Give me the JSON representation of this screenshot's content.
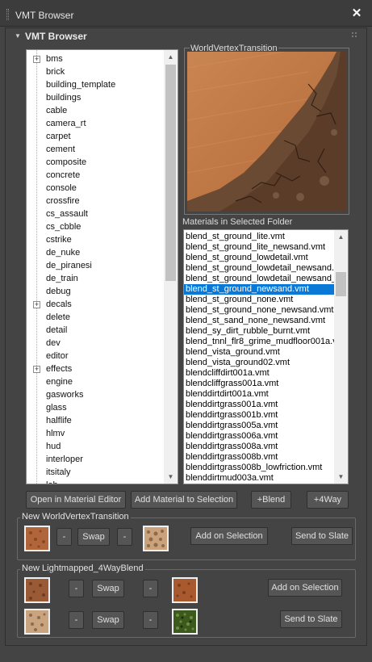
{
  "window": {
    "title": "VMT Browser"
  },
  "rollout": {
    "title": "VMT Browser"
  },
  "tree": {
    "items": [
      {
        "label": "bms",
        "expandable": true
      },
      {
        "label": "brick",
        "expandable": false
      },
      {
        "label": "building_template",
        "expandable": false
      },
      {
        "label": "buildings",
        "expandable": false
      },
      {
        "label": "cable",
        "expandable": false
      },
      {
        "label": "camera_rt",
        "expandable": false
      },
      {
        "label": "carpet",
        "expandable": false
      },
      {
        "label": "cement",
        "expandable": false
      },
      {
        "label": "composite",
        "expandable": false
      },
      {
        "label": "concrete",
        "expandable": false
      },
      {
        "label": "console",
        "expandable": false
      },
      {
        "label": "crossfire",
        "expandable": false
      },
      {
        "label": "cs_assault",
        "expandable": false
      },
      {
        "label": "cs_cbble",
        "expandable": false
      },
      {
        "label": "cstrike",
        "expandable": false
      },
      {
        "label": "de_nuke",
        "expandable": false
      },
      {
        "label": "de_piranesi",
        "expandable": false
      },
      {
        "label": "de_train",
        "expandable": false
      },
      {
        "label": "debug",
        "expandable": false
      },
      {
        "label": "decals",
        "expandable": true
      },
      {
        "label": "delete",
        "expandable": false
      },
      {
        "label": "detail",
        "expandable": false
      },
      {
        "label": "dev",
        "expandable": false
      },
      {
        "label": "editor",
        "expandable": false
      },
      {
        "label": "effects",
        "expandable": true
      },
      {
        "label": "engine",
        "expandable": false
      },
      {
        "label": "gasworks",
        "expandable": false
      },
      {
        "label": "glass",
        "expandable": false
      },
      {
        "label": "halflife",
        "expandable": false
      },
      {
        "label": "hlmv",
        "expandable": false
      },
      {
        "label": "hud",
        "expandable": false
      },
      {
        "label": "interloper",
        "expandable": false
      },
      {
        "label": "itsitaly",
        "expandable": false
      },
      {
        "label": "lab",
        "expandable": false
      }
    ]
  },
  "preview": {
    "label": "WorldVertexTransition"
  },
  "materials": {
    "label": "Materials in Selected Folder",
    "selected_index": 5,
    "items": [
      "blend_st_ground_lite.vmt",
      "blend_st_ground_lite_newsand.vmt",
      "blend_st_ground_lowdetail.vmt",
      "blend_st_ground_lowdetail_newsand.",
      "blend_st_ground_lowdetail_newsand_",
      "blend_st_ground_newsand.vmt",
      "blend_st_ground_none.vmt",
      "blend_st_ground_none_newsand.vmt",
      "blend_st_sand_none_newsand.vmt",
      "blend_sy_dirt_rubble_burnt.vmt",
      "blend_tnnl_flr8_grime_mudfloor001a.v",
      "blend_vista_ground.vmt",
      "blend_vista_ground02.vmt",
      "blendcliffdirt001a.vmt",
      "blendcliffgrass001a.vmt",
      "blenddirtdirt001a.vmt",
      "blenddirtgrass001a.vmt",
      "blenddirtgrass001b.vmt",
      "blenddirtgrass005a.vmt",
      "blenddirtgrass006a.vmt",
      "blenddirtgrass008a.vmt",
      "blenddirtgrass008b.vmt",
      "blenddirtgrass008b_lowfriction.vmt",
      "blenddirtmud003a.vmt"
    ]
  },
  "actions": {
    "open_editor": "Open in Material Editor",
    "add_to_selection": "Add Material to Selection",
    "plus_blend": "+Blend",
    "plus_4way": "+4Way"
  },
  "wvt_group": {
    "label": "New WorldVertexTransition",
    "minus": "-",
    "swap": "Swap",
    "add_on_selection": "Add on Selection",
    "send_to_slate": "Send to Slate"
  },
  "fourway_group": {
    "label": "New Lightmapped_4WayBlend",
    "minus": "-",
    "swap": "Swap",
    "add_on_selection": "Add on Selection",
    "send_to_slate": "Send to Slate"
  },
  "colors": {
    "panel_bg": "#444444",
    "selection": "#0a78d7",
    "dirt": "#b0653a",
    "sand": "#caa27c",
    "grass": "#3d5a1e"
  }
}
